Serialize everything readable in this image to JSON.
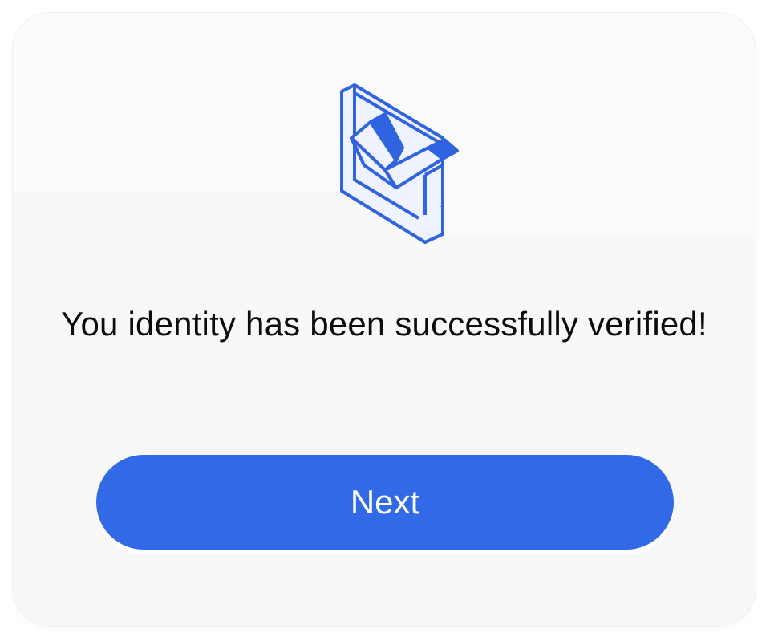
{
  "dialog": {
    "icon": "verified-check-shield-icon",
    "message": "You identity has been successfully verified!",
    "next_label": "Next"
  },
  "colors": {
    "accent": "#3169e6",
    "illustration_stroke": "#2f63e0",
    "illustration_fill": "#eef3ff",
    "text": "#0c0c0c",
    "card_background": "#f8f8f8"
  }
}
